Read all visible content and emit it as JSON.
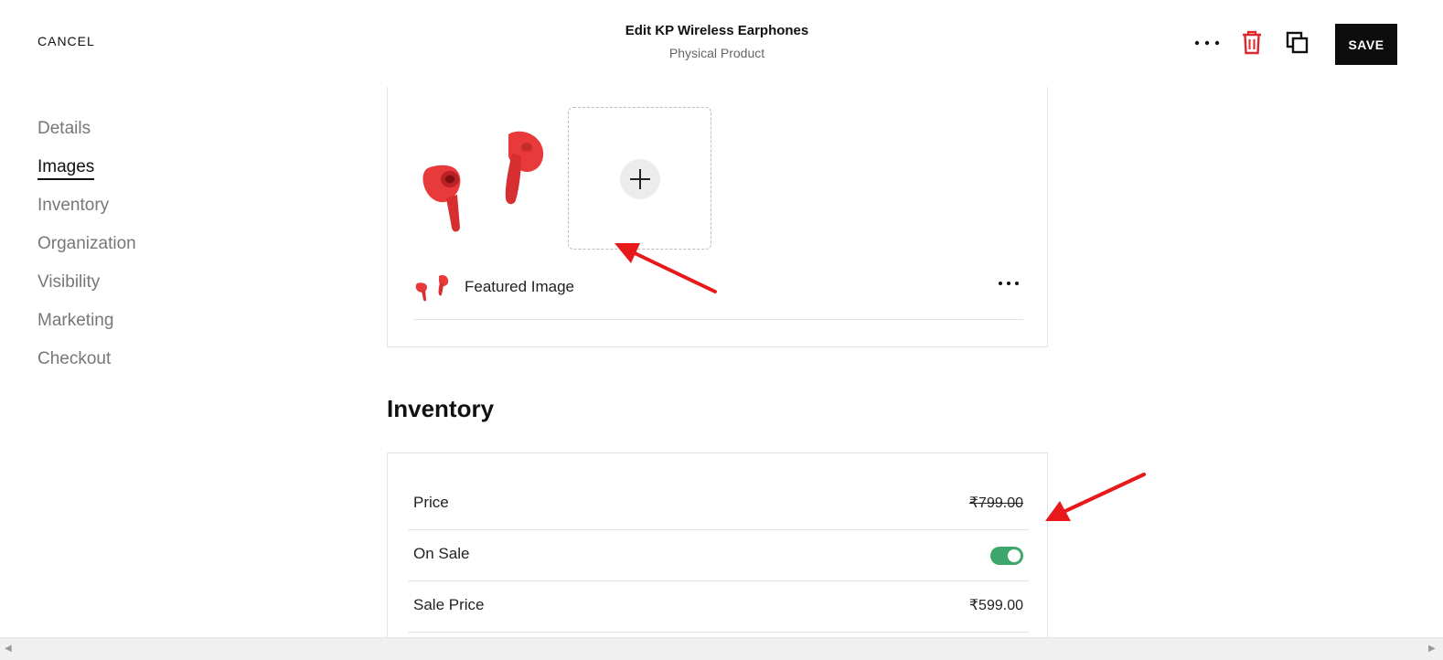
{
  "header": {
    "cancel_label": "CANCEL",
    "title": "Edit KP Wireless Earphones",
    "subtitle": "Physical Product",
    "save_label": "SAVE",
    "icons": [
      "more-horizontal-icon",
      "trash-icon",
      "duplicate-icon"
    ]
  },
  "sidebar": {
    "items": [
      {
        "label": "Details",
        "active": false
      },
      {
        "label": "Images",
        "active": true
      },
      {
        "label": "Inventory",
        "active": false
      },
      {
        "label": "Organization",
        "active": false
      },
      {
        "label": "Visibility",
        "active": false
      },
      {
        "label": "Marketing",
        "active": false
      },
      {
        "label": "Checkout",
        "active": false
      }
    ]
  },
  "images": {
    "featured_label": "Featured Image"
  },
  "inventory": {
    "heading": "Inventory",
    "price_label": "Price",
    "price_value": "₹799.00",
    "on_sale_label": "On Sale",
    "on_sale": true,
    "sale_price_label": "Sale Price",
    "sale_price_value": "₹599.00"
  },
  "colors": {
    "accent_toggle": "#3ea66a",
    "annotation_arrow": "#e8191b",
    "product_red": "#e8393b",
    "trash_red": "#e0262b"
  }
}
